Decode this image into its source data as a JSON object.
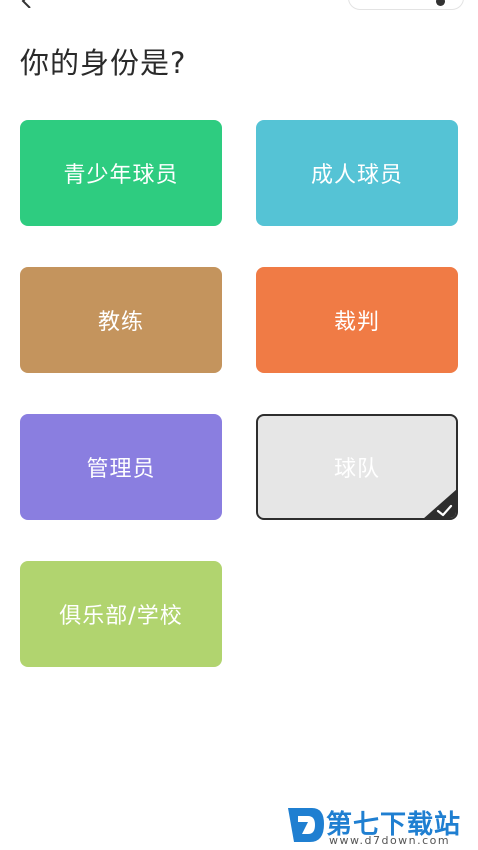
{
  "page": {
    "title": "你的身份是?"
  },
  "roles": [
    {
      "label": "青少年球员",
      "color": "#2ecc80",
      "selected": false
    },
    {
      "label": "成人球员",
      "color": "#55c3d5",
      "selected": false
    },
    {
      "label": "教练",
      "color": "#c4945d",
      "selected": false
    },
    {
      "label": "裁判",
      "color": "#f07b45",
      "selected": false
    },
    {
      "label": "管理员",
      "color": "#8a7ee0",
      "selected": false
    },
    {
      "label": "球队",
      "color": "#e6e6e6",
      "selected": true
    },
    {
      "label": "俱乐部/学校",
      "color": "#b1d46f",
      "selected": false
    }
  ],
  "watermark": {
    "name": "第七下载站",
    "url": "www.d7down.com",
    "color": "#1f7fd1"
  }
}
